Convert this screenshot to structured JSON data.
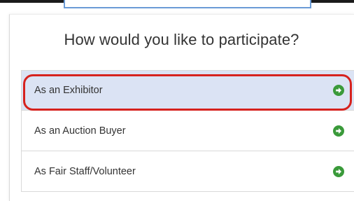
{
  "heading": "How would you like to participate?",
  "options": [
    {
      "label": "As an Exhibitor",
      "selected": true
    },
    {
      "label": "As an Auction Buyer",
      "selected": false
    },
    {
      "label": "As Fair Staff/Volunteer",
      "selected": false
    }
  ],
  "colors": {
    "arrow": "#3a9a3a",
    "selected_bg": "#dbe3f4",
    "highlight": "#d6221e"
  },
  "icons": {
    "option_arrow": "arrow-circle-right-icon"
  }
}
